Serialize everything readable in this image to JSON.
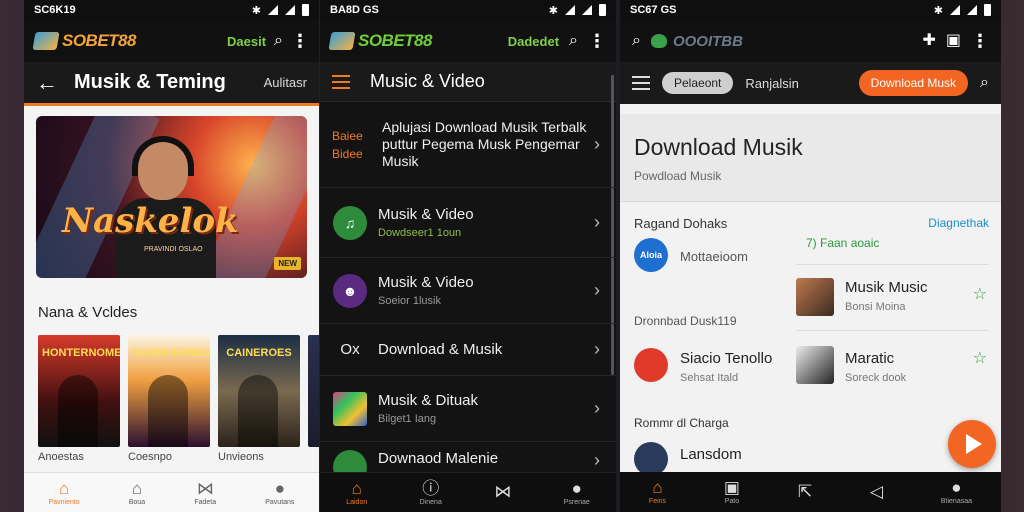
{
  "panel1": {
    "status_time": "SC6K19",
    "logo": "SOBET88",
    "header_link": "Daesit",
    "title": "Musik & Teming",
    "title_tab": "Aulitasr",
    "hero_text": "Naskelok",
    "hero_sub": "PRAVINDI OSLAO",
    "hero_badge": "NEW",
    "section_title": "Nana & Vcldes",
    "posters": [
      {
        "title": "HONTERNOMENDT",
        "caption": "Anoestas"
      },
      {
        "title": "DUREFIFERES",
        "caption": "Coesnpo"
      },
      {
        "title": "CAINEROES",
        "caption": "Unvieons"
      },
      {
        "title": "",
        "caption": ""
      }
    ],
    "nav": [
      {
        "icon": "home-icon",
        "glyph": "⌂",
        "label": "Pavniento"
      },
      {
        "icon": "store-icon",
        "glyph": "⌂",
        "label": "Boua"
      },
      {
        "icon": "bowtie-icon",
        "glyph": "⋈",
        "label": "Fadeta"
      },
      {
        "icon": "person-icon",
        "glyph": "●",
        "label": "Pavutans"
      }
    ]
  },
  "panel2": {
    "status_time": "BA8D GS",
    "logo": "SOBET88",
    "header_link": "Dadedet",
    "title": "Music & Video",
    "rows": [
      {
        "lead": "Baiee Bidee",
        "title": "Aplujasi Download Musik Terbalk puttur Pegema Musk Pengemar Musik",
        "subtitle": ""
      },
      {
        "lead": "music-badge",
        "title": "Musik & Video",
        "subtitle": "Dowdseer1 1oun"
      },
      {
        "lead": "character-avatar",
        "title": "Musik & Video",
        "subtitle": "Soeior 1lusik"
      },
      {
        "lead": "Ox",
        "title": "Download & Musik",
        "subtitle": ""
      },
      {
        "lead": "art-thumb",
        "title": "Musik & Dituak",
        "subtitle": "Bilget1 Iang"
      },
      {
        "lead": "green-badge",
        "title": "Downaod Malenie",
        "subtitle": ""
      }
    ],
    "nav": [
      {
        "icon": "home-icon",
        "glyph": "⌂",
        "label": "Laidon"
      },
      {
        "icon": "info-icon",
        "glyph": "ⓘ",
        "label": "Dinena"
      },
      {
        "icon": "bowtie-icon",
        "glyph": "⋈",
        "label": ""
      },
      {
        "icon": "person-icon",
        "glyph": "●",
        "label": "Psrenae"
      }
    ]
  },
  "panel3": {
    "status_time": "SC67 GS",
    "logo": "OOOITBB",
    "chip_active": "Pelaeont",
    "chip_text": "Ranjalsin",
    "chip_button": "Download Musk",
    "header_title": "Download Musik",
    "header_sub": "Powdload Musik",
    "section1": "Ragand Dohaks",
    "section1_link": "Diagnethak",
    "stat": "7) Faan aoaic",
    "item_left1": {
      "name": "Mottaeioom",
      "logo": "Aloia"
    },
    "right_items": [
      {
        "name": "Musik Music",
        "sub": "Bonsi Moina"
      },
      {
        "name": "Maratic",
        "sub": "Soreck dook"
      }
    ],
    "section2": "Dronnbad Dusk119",
    "item_left2": {
      "name": "Siacio Tenollo",
      "sub": "Sehsat Itald"
    },
    "section3": "Rommr dl Charga",
    "item_left3": {
      "name": "Lansdom"
    },
    "nav": [
      {
        "icon": "home-icon",
        "glyph": "⌂",
        "label": "Feins"
      },
      {
        "icon": "video-icon",
        "glyph": "▣",
        "label": "Pato"
      },
      {
        "icon": "share-icon",
        "glyph": "⇱",
        "label": ""
      },
      {
        "icon": "send-icon",
        "glyph": "◁",
        "label": ""
      },
      {
        "icon": "person-icon",
        "glyph": "●",
        "label": "Btienasaa"
      }
    ]
  }
}
